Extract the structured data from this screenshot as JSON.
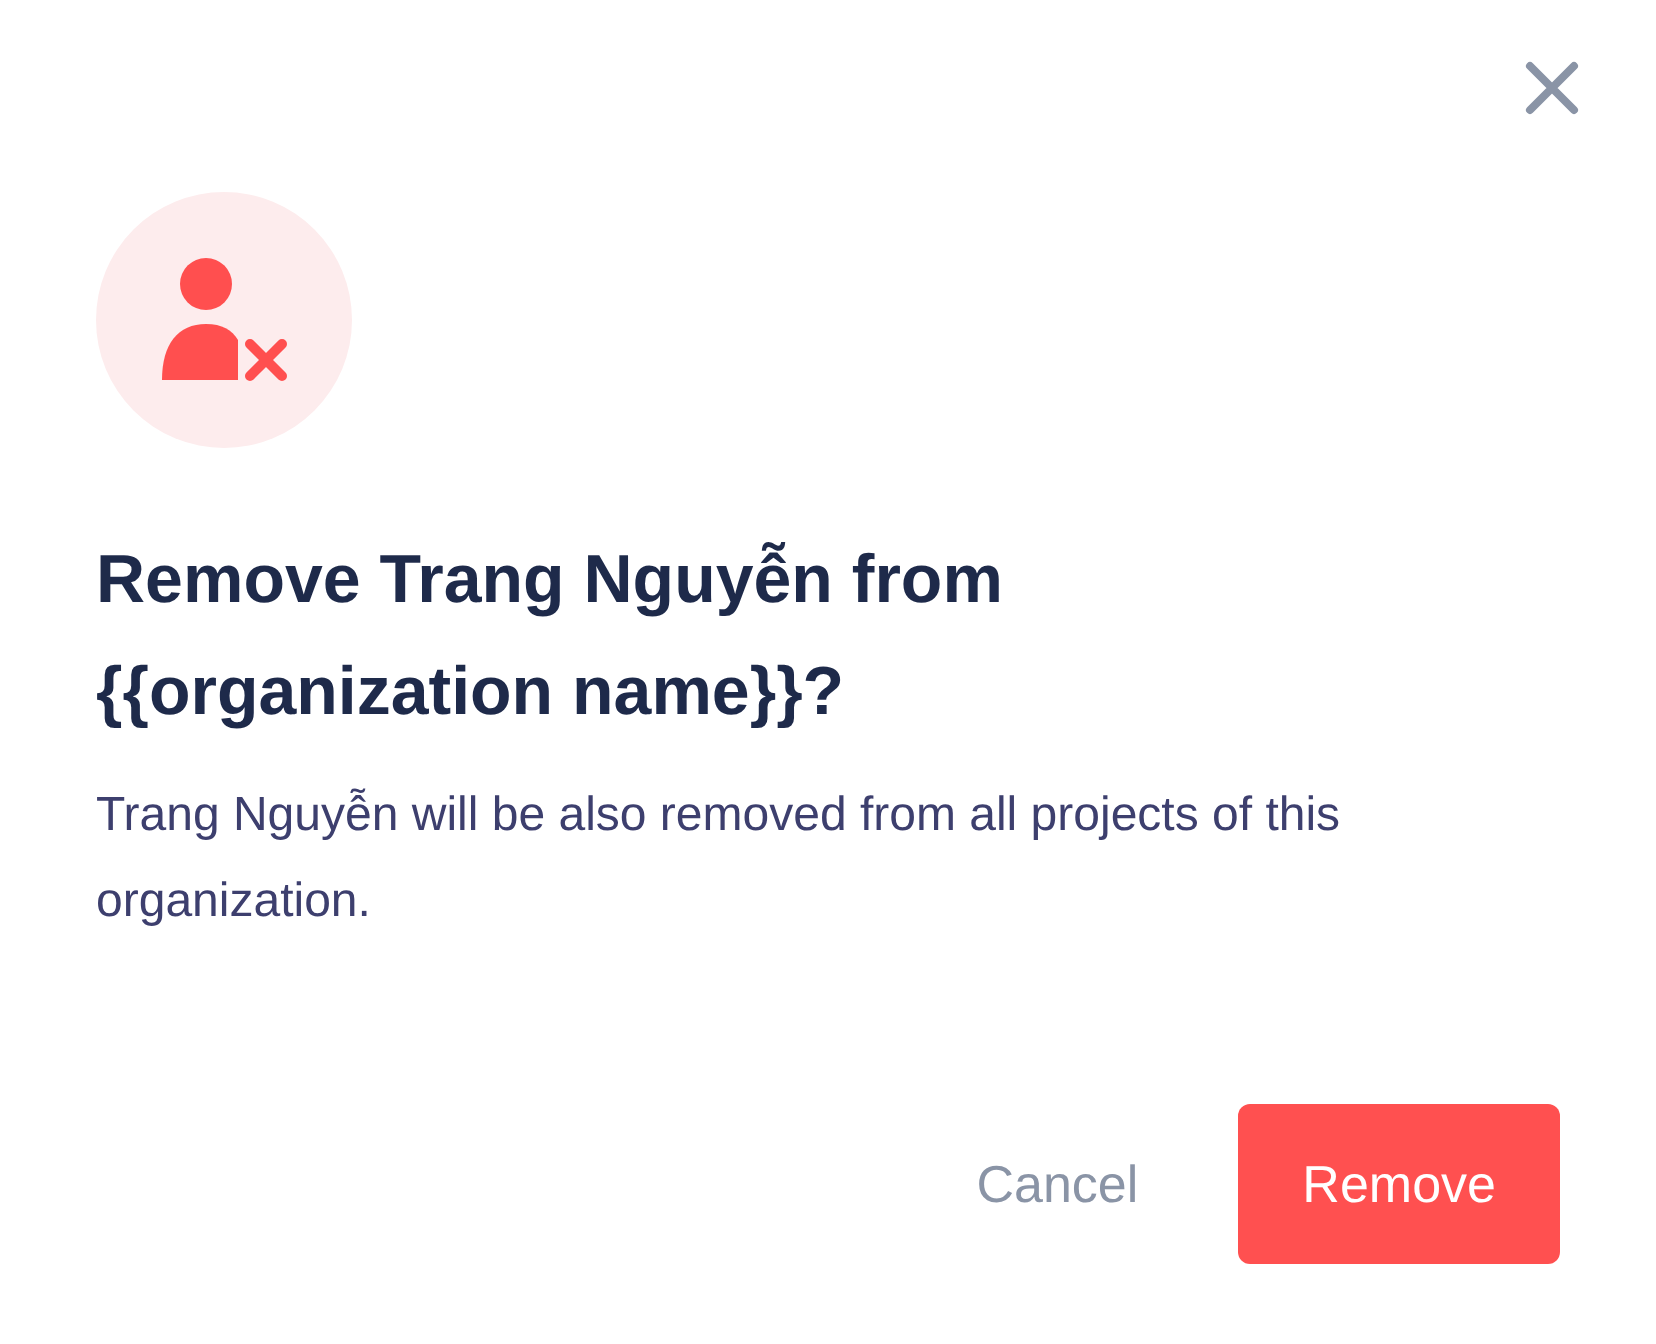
{
  "dialog": {
    "title": "Remove Trang Nguyễn from {{organization name}}?",
    "message": "Trang Nguyễn will be also removed from all projects of this organization.",
    "buttons": [
      {
        "label": "Cancel",
        "kind": "secondary"
      },
      {
        "label": "Remove",
        "kind": "danger"
      }
    ]
  }
}
